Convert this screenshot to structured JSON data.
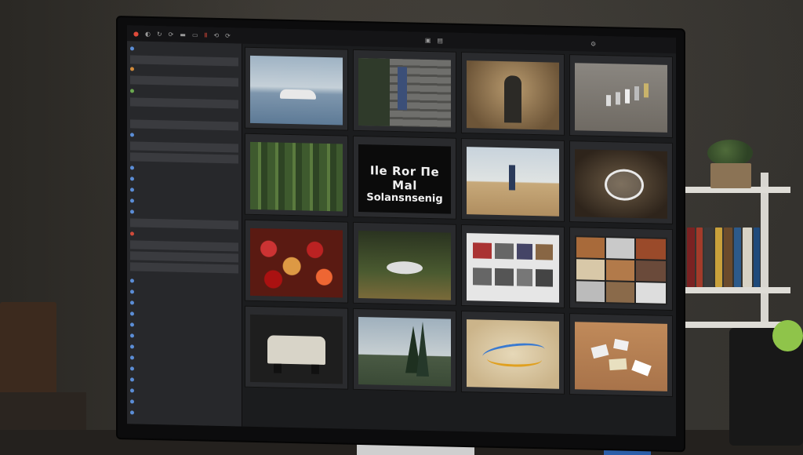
{
  "photo_grid": {
    "poster_text_line1": "Ile Ror Πe Mal",
    "poster_text_line2": "Solansnsenig"
  },
  "icons": [
    "toolbar-icon",
    "star-icon",
    "flag-icon",
    "pin-icon"
  ],
  "colors": {
    "accent_green": "#6aa84f",
    "accent_red": "#e04a3a",
    "sidebar_blue": "#5b8dd6"
  }
}
